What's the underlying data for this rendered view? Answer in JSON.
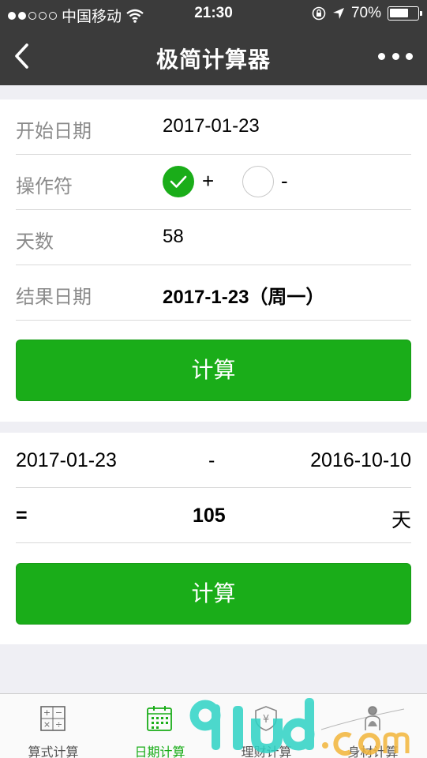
{
  "status_bar": {
    "carrier": "中国移动",
    "time": "21:30",
    "battery": "70%",
    "battery_level": 0.7,
    "icons": [
      "signal-dots",
      "wifi-icon",
      "rotation-lock-icon",
      "location-arrow-icon",
      "battery-icon"
    ]
  },
  "nav": {
    "title": "极简计算器",
    "back_icon": "chevron-left-icon",
    "more_icon": "more-dots-icon"
  },
  "date_calc": {
    "start_label": "开始日期",
    "start_value": "2017-01-23",
    "operator_label": "操作符",
    "op_plus": "+",
    "op_minus": "-",
    "selected_op": "+",
    "days_label": "天数",
    "days_value": "58",
    "result_label": "结果日期",
    "result_value": "2017-1-23（周一）",
    "button": "计算"
  },
  "diff_calc": {
    "date_a": "2017-01-23",
    "minus": "-",
    "date_b": "2016-10-10",
    "equals": "=",
    "result": "105",
    "unit": "天",
    "button": "计算"
  },
  "tabs": [
    {
      "label": "算式计算",
      "icon": "calculator-icon",
      "active": false
    },
    {
      "label": "日期计算",
      "icon": "calendar-icon",
      "active": true
    },
    {
      "label": "理财计算",
      "icon": "money-shield-icon",
      "active": false
    },
    {
      "label": "身材计算",
      "icon": "body-icon",
      "active": false
    }
  ],
  "colors": {
    "nav_bg": "#3b3b3b",
    "accent": "#1aad19",
    "page_bg": "#efeff4"
  }
}
